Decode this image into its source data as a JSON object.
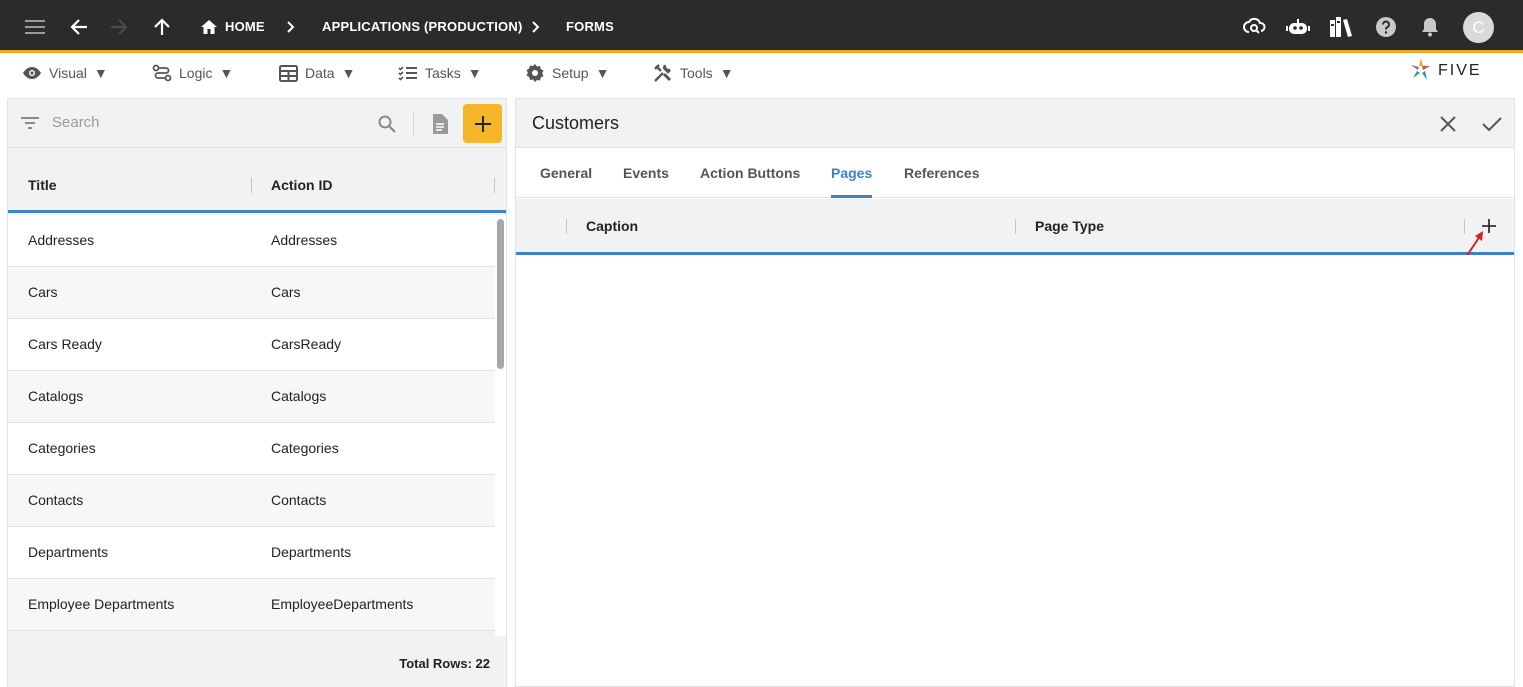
{
  "topbar": {
    "breadcrumbs": [
      "HOME",
      "APPLICATIONS (PRODUCTION)",
      "FORMS"
    ],
    "avatar_letter": "C"
  },
  "menu": {
    "items": [
      "Visual",
      "Logic",
      "Data",
      "Tasks",
      "Setup",
      "Tools"
    ]
  },
  "logo_text": "FIVE",
  "left": {
    "search_placeholder": "Search",
    "columns": [
      "Title",
      "Action ID"
    ],
    "rows": [
      {
        "title": "Addresses",
        "action_id": "Addresses"
      },
      {
        "title": "Cars",
        "action_id": "Cars"
      },
      {
        "title": "Cars Ready",
        "action_id": "CarsReady"
      },
      {
        "title": "Catalogs",
        "action_id": "Catalogs"
      },
      {
        "title": "Categories",
        "action_id": "Categories"
      },
      {
        "title": "Contacts",
        "action_id": "Contacts"
      },
      {
        "title": "Departments",
        "action_id": "Departments"
      },
      {
        "title": "Employee Departments",
        "action_id": "EmployeeDepartments"
      }
    ],
    "total_rows": "Total Rows: 22"
  },
  "right": {
    "title": "Customers",
    "tabs": [
      "General",
      "Events",
      "Action Buttons",
      "Pages",
      "References"
    ],
    "active_tab": "Pages",
    "columns": [
      "Caption",
      "Page Type"
    ]
  },
  "colors": {
    "topbar": "#2b2b2b",
    "accent_orange": "#f6b52b",
    "accent_blue": "#3d82c6",
    "annotation_arrow": "#e02020"
  }
}
